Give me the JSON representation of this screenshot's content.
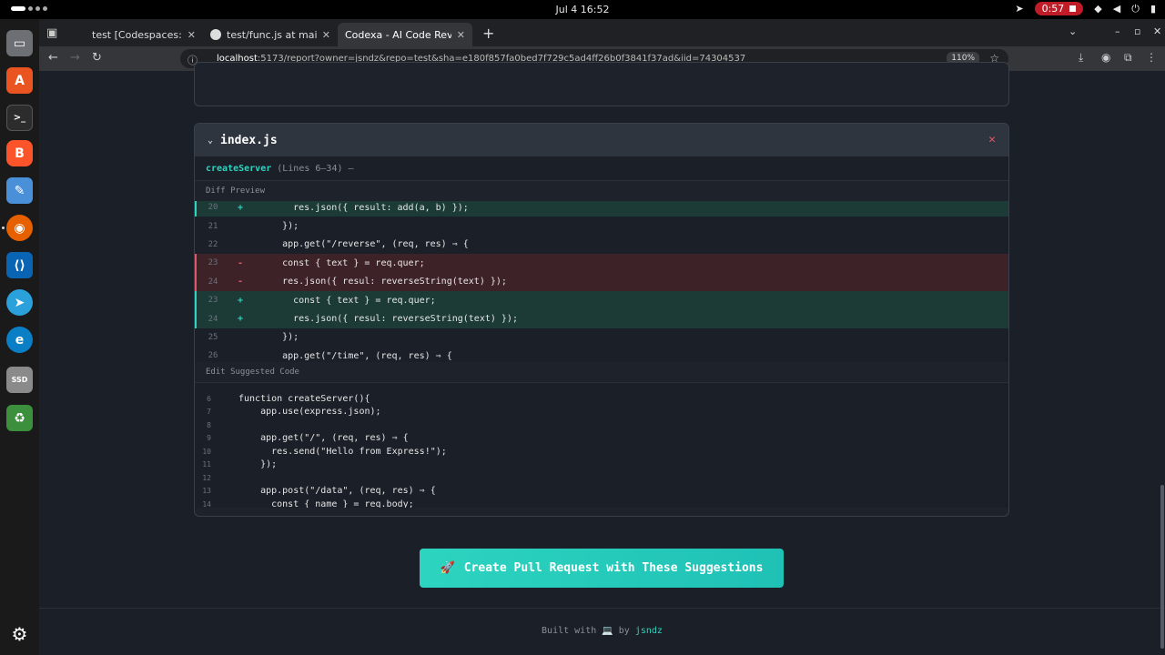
{
  "system": {
    "clock": "Jul 4  16:52",
    "recording_time": "0:57"
  },
  "browser": {
    "tabs": [
      {
        "title": "test [Codespaces: turbo w",
        "active": false
      },
      {
        "title": "test/func.js at main · jsnd",
        "active": false
      },
      {
        "title": "Codexa - AI Code Review Ass",
        "active": true
      }
    ],
    "url_host": "localhost",
    "url_rest": ":5173/report?owner=jsndz&repo=test&sha=e180f857fa0bed7f729c5ad4ff26b0f3841f37ad&iid=74304537",
    "zoom": "110%"
  },
  "file_card": {
    "filename": "index.js",
    "function_name": "createServer",
    "line_range": "(Lines 6–34) —",
    "diff_label": "Diff Preview",
    "edit_label": "Edit Suggested Code",
    "diff_rows": [
      {
        "ln": "20",
        "sign": "+",
        "type": "add",
        "code": "      res.json({ result: add(a, b) });"
      },
      {
        "ln": "21",
        "sign": "",
        "type": "ctx",
        "code": "    });"
      },
      {
        "ln": "22",
        "sign": "",
        "type": "ctx",
        "code": "    app.get(\"/reverse\", (req, res) ⇒ {"
      },
      {
        "ln": "23",
        "sign": "-",
        "type": "del",
        "code": "    const { text } = req.quer;"
      },
      {
        "ln": "24",
        "sign": "-",
        "type": "del",
        "code": "    res.json({ resul: reverseString(text) });"
      },
      {
        "ln": "23",
        "sign": "+",
        "type": "add",
        "code": "      const { text } = req.quer;"
      },
      {
        "ln": "24",
        "sign": "+",
        "type": "add",
        "code": "      res.json({ resul: reverseString(text) });"
      },
      {
        "ln": "25",
        "sign": "",
        "type": "ctx",
        "code": "    });"
      },
      {
        "ln": "26",
        "sign": "",
        "type": "ctx",
        "code": "    app.get(\"/time\", (req, res) ⇒ {"
      }
    ],
    "editor_rows": [
      {
        "ln": "6",
        "code": "function createServer(){"
      },
      {
        "ln": "7",
        "code": "    app.use(express.json);"
      },
      {
        "ln": "8",
        "code": ""
      },
      {
        "ln": "9",
        "code": "    app.get(\"/\", (req, res) ⇒ {"
      },
      {
        "ln": "10",
        "code": "      res.send(\"Hello from Express!\");"
      },
      {
        "ln": "11",
        "code": "    });"
      },
      {
        "ln": "12",
        "code": ""
      },
      {
        "ln": "13",
        "code": "    app.post(\"/data\", (req, res) ⇒ {"
      },
      {
        "ln": "14",
        "code": "      const { name } = req.body;"
      }
    ]
  },
  "cta_label": "Create Pull Request with These Suggestions",
  "footer": {
    "prefix": "Built with",
    "middle": "by",
    "author": "jsndz"
  },
  "colors": {
    "accent": "#2dd4bf",
    "delete": "#e0566a",
    "background": "#1b1f27"
  }
}
